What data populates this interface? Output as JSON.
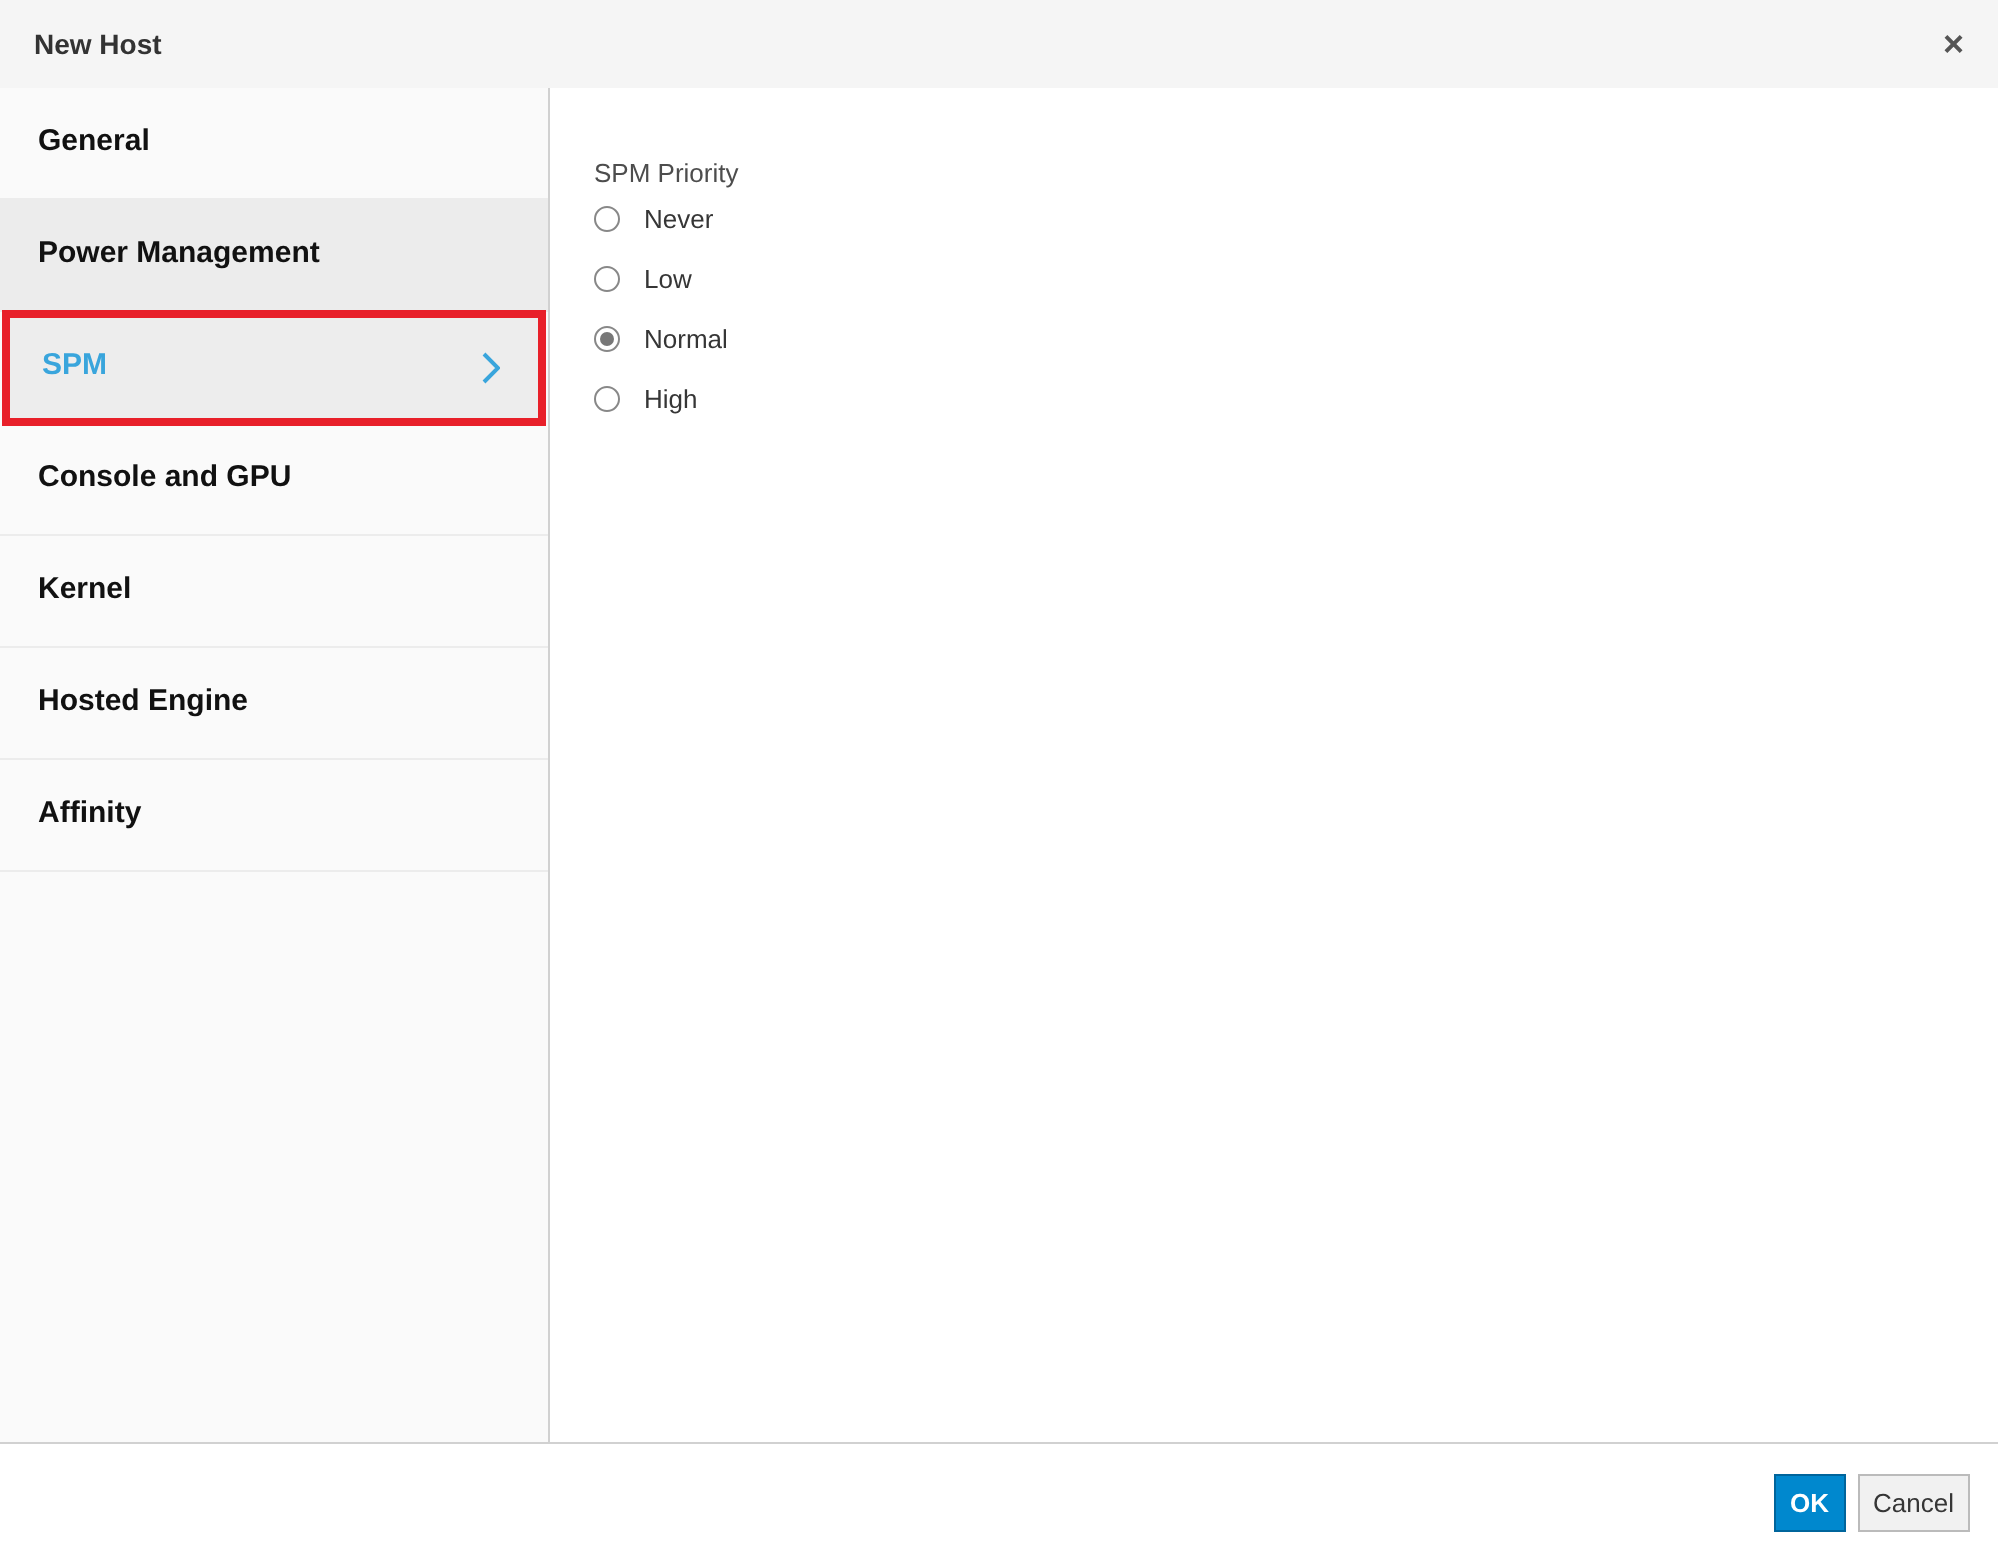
{
  "dialog": {
    "title": "New Host",
    "close": "×"
  },
  "sidebar": {
    "items": [
      {
        "label": "General",
        "selected": false,
        "hovered": false,
        "highlighted": false
      },
      {
        "label": "Power Management",
        "selected": false,
        "hovered": true,
        "highlighted": false
      },
      {
        "label": "SPM",
        "selected": true,
        "hovered": false,
        "highlighted": true
      },
      {
        "label": "Console and GPU",
        "selected": false,
        "hovered": false,
        "highlighted": false
      },
      {
        "label": "Kernel",
        "selected": false,
        "hovered": false,
        "highlighted": false
      },
      {
        "label": "Hosted Engine",
        "selected": false,
        "hovered": false,
        "highlighted": false
      },
      {
        "label": "Affinity",
        "selected": false,
        "hovered": false,
        "highlighted": false
      }
    ]
  },
  "spm_priority": {
    "label": "SPM Priority",
    "options": [
      {
        "label": "Never",
        "selected": false
      },
      {
        "label": "Low",
        "selected": false
      },
      {
        "label": "Normal",
        "selected": true
      },
      {
        "label": "High",
        "selected": false
      }
    ]
  },
  "buttons": [
    {
      "label": "OK",
      "kind": "primary"
    },
    {
      "label": "Cancel",
      "kind": "secondary"
    }
  ]
}
